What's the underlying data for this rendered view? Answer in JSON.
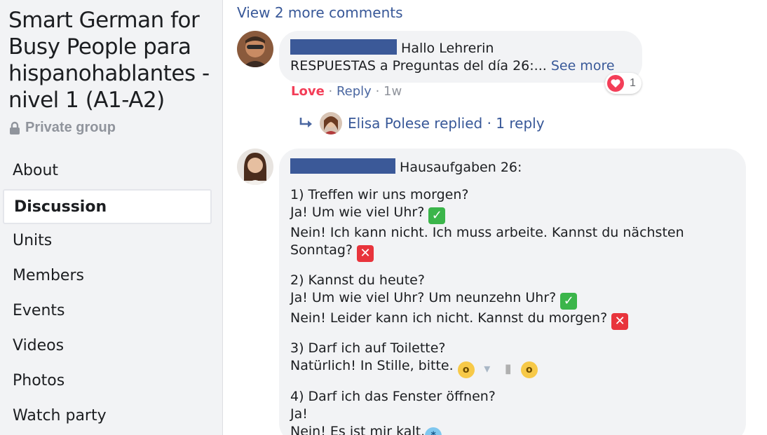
{
  "group": {
    "title": "Smart German for Busy People para hispanohablantes - nivel 1 (A1-A2)",
    "privacy": "Private group"
  },
  "nav": {
    "items": [
      {
        "label": "About"
      },
      {
        "label": "Discussion"
      },
      {
        "label": "Units"
      },
      {
        "label": "Members"
      },
      {
        "label": "Events"
      },
      {
        "label": "Videos"
      },
      {
        "label": "Photos"
      },
      {
        "label": "Watch party"
      }
    ],
    "active": "Discussion"
  },
  "comments": {
    "view_more": "View 2 more comments",
    "first": {
      "line1": "Hallo Lehrerin",
      "line2": "RESPUESTAS a Preguntas del día 26:...",
      "see_more": "See more",
      "actions": {
        "love": "Love",
        "reply": "Reply",
        "time": "1w"
      },
      "reaction_count": "1",
      "replies": {
        "text": "Elisa Polese replied · 1 reply"
      }
    },
    "second": {
      "heading": "Hausaufgaben 26:",
      "q1_line1": "1) Treffen wir uns morgen?",
      "q1_line2": "Ja! Um wie viel Uhr?",
      "q1_line3": "Nein! Ich kann nicht. Ich muss arbeite. Kannst du nächsten",
      "q1_line4": "Sonntag?",
      "q2_line1": "2) Kannst du heute?",
      "q2_line2": "Ja! Um wie viel Uhr? Um neunzehn Uhr?",
      "q2_line3": "Nein! Leider kann ich nicht. Kannst du morgen?",
      "q3_line1": "3) Darf ich auf Toilette?",
      "q3_line2": "Natürlich! In Stille, bitte.",
      "q4_line1": "4) Darf ich das Fenster öffnen?",
      "q4_line2": "Ja!",
      "q4_line3": "Nein! Es ist mir kalt."
    }
  },
  "colors": {
    "link": "#385898",
    "love": "#f33e58",
    "sidebar_bg": "#f2f3f5",
    "bubble_bg": "#f2f3f5",
    "redaction": "#3b5998"
  }
}
